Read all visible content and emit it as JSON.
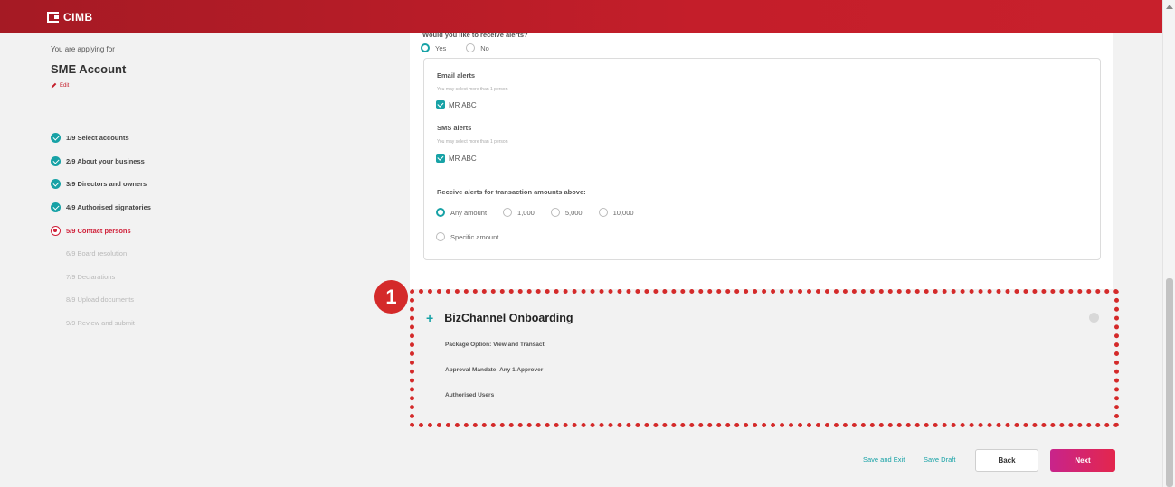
{
  "header": {
    "logo_text": "CIMB"
  },
  "sidebar": {
    "applying_label": "You are applying for",
    "account_name": "SME Account",
    "edit_label": "Edit",
    "steps": [
      {
        "label": "1/9 Select accounts",
        "status": "done"
      },
      {
        "label": "2/9 About your business",
        "status": "done"
      },
      {
        "label": "3/9 Directors and owners",
        "status": "done"
      },
      {
        "label": "4/9 Authorised signatories",
        "status": "done"
      },
      {
        "label": "5/9 Contact persons",
        "status": "active"
      },
      {
        "label": "6/9 Board resolution",
        "status": "pending"
      },
      {
        "label": "7/9 Declarations",
        "status": "pending"
      },
      {
        "label": "8/9 Upload documents",
        "status": "pending"
      },
      {
        "label": "9/9 Review and submit",
        "status": "pending"
      }
    ]
  },
  "alerts": {
    "question": "Would you like to receive alerts?",
    "yes_label": "Yes",
    "no_label": "No",
    "email_title": "Email alerts",
    "email_help": "You may select more than 1 person",
    "email_person": "MR ABC",
    "sms_title": "SMS alerts",
    "sms_help": "You may select more than 1 person",
    "sms_person": "MR ABC",
    "amount_title": "Receive alerts for transaction amounts above:",
    "amount_options": [
      "Any amount",
      "1,000",
      "5,000",
      "10,000"
    ],
    "specific_label": "Specific amount"
  },
  "biz": {
    "badge": "1",
    "title": "BizChannel Onboarding",
    "package": "Package Option: View and Transact",
    "mandate": "Approval Mandate: Any 1 Approver",
    "users": "Authorised Users"
  },
  "footer": {
    "save_exit": "Save and Exit",
    "save_draft": "Save Draft",
    "back": "Back",
    "next": "Next"
  },
  "colors": {
    "brand_red": "#c41e2a",
    "accent_teal": "#17a2a6",
    "highlight_red": "#d42a2a"
  }
}
